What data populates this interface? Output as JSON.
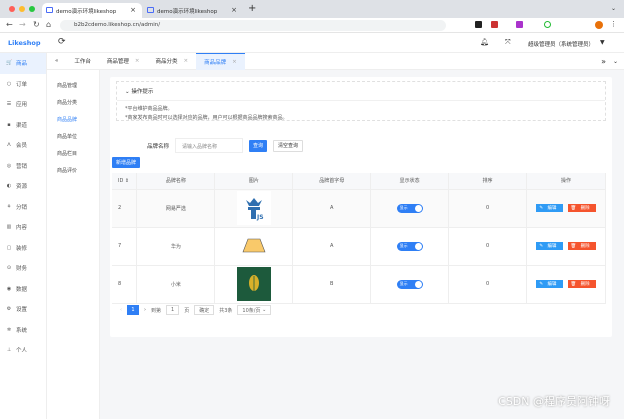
{
  "browser": {
    "tabs": [
      {
        "title": "demo演示环境likeshop"
      },
      {
        "title": "demo演示环境likeshop"
      }
    ],
    "url": "b2b2cdemo.likeshop.cn/admin/",
    "new_tab": "+"
  },
  "header": {
    "logo": "Likeshop",
    "user": "超级管理员（系统管理员）",
    "refresh_icon": "⟳"
  },
  "sidebar": {
    "items": [
      {
        "label": "商品",
        "icon": "🛒"
      },
      {
        "label": "订单",
        "icon": "○"
      },
      {
        "label": "应用",
        "icon": "☰"
      },
      {
        "label": "渠道",
        "icon": "▪"
      },
      {
        "label": "会员",
        "icon": "ꓥ"
      },
      {
        "label": "营销",
        "icon": "◎"
      },
      {
        "label": "资源",
        "icon": "◐"
      },
      {
        "label": "分销",
        "icon": "⚘"
      },
      {
        "label": "内容",
        "icon": "▥"
      },
      {
        "label": "装修",
        "icon": "▢"
      },
      {
        "label": "财务",
        "icon": "⊙"
      },
      {
        "label": "数据",
        "icon": "◉"
      },
      {
        "label": "设置",
        "icon": "⚙"
      },
      {
        "label": "系统",
        "icon": "✲"
      },
      {
        "label": "个人",
        "icon": "⊥"
      }
    ]
  },
  "submenu": {
    "title": "商品",
    "items": [
      "商品管理",
      "商品分类",
      "商品品牌",
      "商品单位",
      "商品栏目",
      "商品评价"
    ]
  },
  "page_tabs": [
    "工作台",
    "商品管理",
    "商品分类",
    "商品品牌"
  ],
  "tips": {
    "title": "操作提示",
    "lines": [
      "*平台维护商品品牌。",
      "*商家发布商品时可以选择对应的品牌，用户可以根据商品品牌搜索商品。"
    ]
  },
  "search": {
    "label": "品牌名称",
    "placeholder": "请输入品牌名称",
    "query": "查询",
    "reset": "清空查询"
  },
  "add_button": "新增品牌",
  "table": {
    "headers": [
      "ID",
      "品牌名称",
      "图片",
      "品牌首字母",
      "显示状态",
      "排序",
      "操作"
    ],
    "rows": [
      {
        "id": "2",
        "name": "网易严选",
        "letter": "A",
        "status": "显示",
        "sort": "0"
      },
      {
        "id": "7",
        "name": "华为",
        "letter": "A",
        "status": "显示",
        "sort": "0"
      },
      {
        "id": "8",
        "name": "小米",
        "letter": "B",
        "status": "显示",
        "sort": "0"
      }
    ],
    "edit": "编辑",
    "delete": "删除"
  },
  "pager": {
    "current": "1",
    "goto": "到第",
    "page_input": "1",
    "page_unit": "页",
    "confirm": "确定",
    "total": "共3条",
    "size": "10条/页"
  },
  "watermark": "CSDN @程序员阿钟呀"
}
